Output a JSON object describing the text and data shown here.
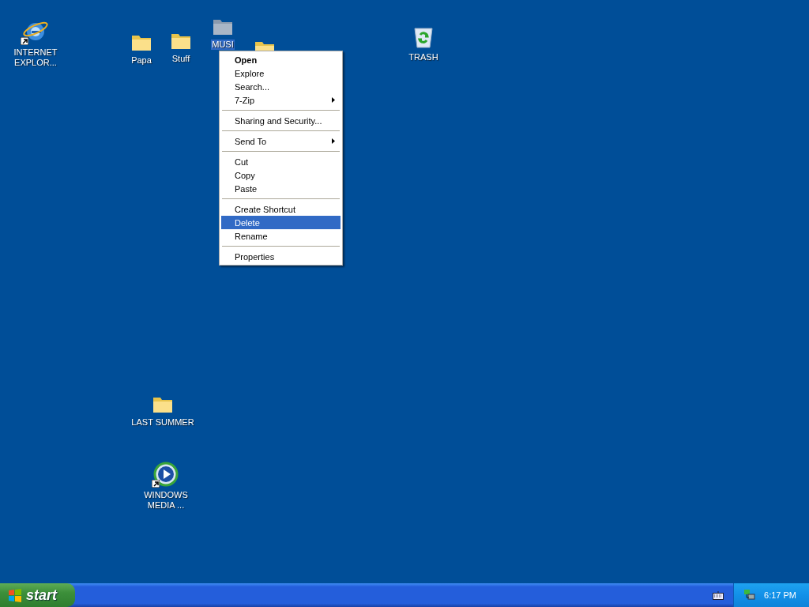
{
  "desktop_icons": [
    {
      "kind": "browser",
      "label": "INTERNET EXPLOR...",
      "shortcut": true,
      "selected": false
    },
    {
      "kind": "folder",
      "label": "Papa",
      "shortcut": false,
      "selected": false
    },
    {
      "kind": "folder",
      "label": "Stuff",
      "shortcut": false,
      "selected": false
    },
    {
      "kind": "folder",
      "label": "MUSI",
      "shortcut": false,
      "selected": true
    },
    {
      "kind": "folder",
      "selected": false
    },
    {
      "kind": "trash",
      "label": "TRASH",
      "shortcut": false,
      "selected": false
    },
    {
      "kind": "folder",
      "label": "LAST SUMMER",
      "shortcut": false,
      "selected": false
    },
    {
      "kind": "media",
      "label": "WINDOWS MEDIA ...",
      "shortcut": true,
      "selected": false
    }
  ],
  "context_menu": {
    "groups": [
      [
        {
          "label": "Open",
          "default": true,
          "submenu": false,
          "selected": false
        },
        {
          "label": "Explore",
          "default": false,
          "submenu": false,
          "selected": false
        },
        {
          "label": "Search...",
          "default": false,
          "submenu": false,
          "selected": false
        },
        {
          "label": "7-Zip",
          "default": false,
          "submenu": true,
          "selected": false
        }
      ],
      [
        {
          "label": "Sharing and Security...",
          "default": false,
          "submenu": false,
          "selected": false
        }
      ],
      [
        {
          "label": "Send To",
          "default": false,
          "submenu": true,
          "selected": false
        }
      ],
      [
        {
          "label": "Cut",
          "default": false,
          "submenu": false,
          "selected": false
        },
        {
          "label": "Copy",
          "default": false,
          "submenu": false,
          "selected": false
        },
        {
          "label": "Paste",
          "default": false,
          "submenu": false,
          "selected": false
        }
      ],
      [
        {
          "label": "Create Shortcut",
          "default": false,
          "submenu": false,
          "selected": false
        },
        {
          "label": "Delete",
          "default": false,
          "submenu": false,
          "selected": true
        },
        {
          "label": "Rename",
          "default": false,
          "submenu": false,
          "selected": false
        }
      ],
      [
        {
          "label": "Properties",
          "default": false,
          "submenu": false,
          "selected": false
        }
      ]
    ]
  },
  "taskbar": {
    "start_label": "start",
    "tray_icons": [
      {
        "kind": "keyboard"
      }
    ],
    "notification_icons": [
      {
        "kind": "network"
      }
    ],
    "clock": "6:17 PM"
  }
}
